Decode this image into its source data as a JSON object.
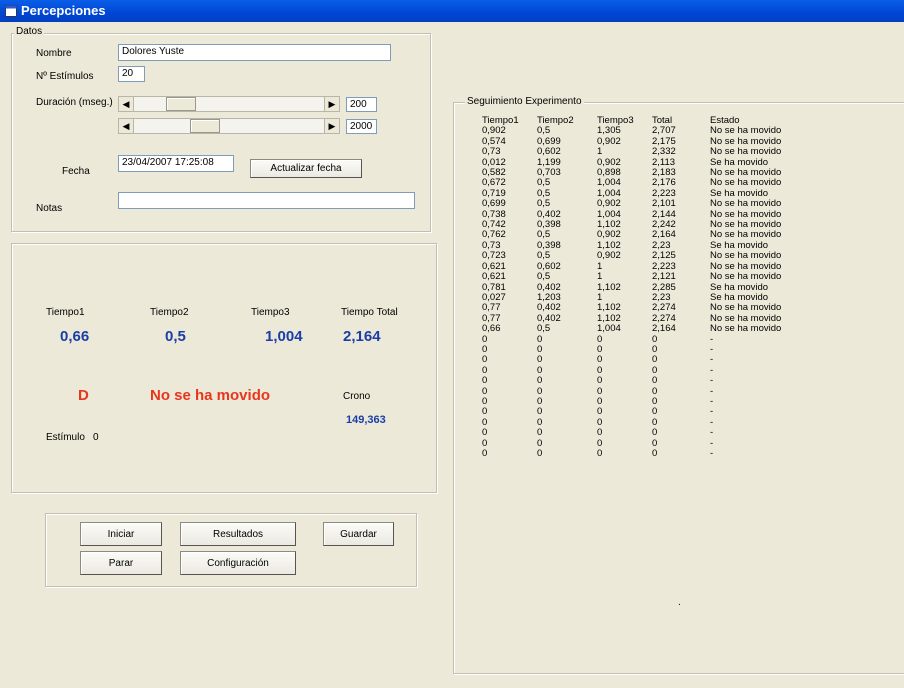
{
  "window": {
    "title": "Percepciones"
  },
  "datos": {
    "legend": "Datos",
    "nombre_label": "Nombre",
    "nombre_value": "Dolores Yuste",
    "estimulos_label": "Nº Estímulos",
    "estimulos_value": "20",
    "duracion_label": "Duración (mseg.)",
    "slider1_value": "200",
    "slider1_level": 0.2,
    "slider2_value": "2000",
    "slider2_level": 0.35,
    "fecha_label": "Fecha",
    "fecha_value": "23/04/2007 17:25:08",
    "actualizar_label": "Actualizar fecha",
    "notas_label": "Notas",
    "notas_value": ""
  },
  "display": {
    "tiempo1_label": "Tiempo1",
    "tiempo2_label": "Tiempo2",
    "tiempo3_label": "Tiempo3",
    "total_label": "Tiempo Total",
    "tiempo1_value": "0,66",
    "tiempo2_value": "0,5",
    "tiempo3_value": "1,004",
    "total_value": "2,164",
    "letter": "D",
    "estado": "No se ha movido",
    "crono_label": "Crono",
    "crono_value": "149,363",
    "estimulo_label": "Estímulo",
    "estimulo_value": "0"
  },
  "buttons": {
    "iniciar": "Iniciar",
    "resultados": "Resultados",
    "guardar": "Guardar",
    "parar": "Parar",
    "configuracion": "Configuración"
  },
  "seguimiento": {
    "legend": "Seguimiento Experimento",
    "headers": [
      "Tiempo1",
      "Tiempo2",
      "Tiempo3",
      "Total",
      "Estado"
    ],
    "rows": [
      [
        "0,902",
        "0,5",
        "1,305",
        "2,707",
        "No se ha movido"
      ],
      [
        "0,574",
        "0,699",
        "0,902",
        "2,175",
        "No se ha movido"
      ],
      [
        "0,73",
        "0,602",
        "1",
        "2,332",
        "No se ha movido"
      ],
      [
        "0,012",
        "1,199",
        "0,902",
        "2,113",
        "Se ha movido"
      ],
      [
        "0,582",
        "0,703",
        "0,898",
        "2,183",
        "No se ha movido"
      ],
      [
        "0,672",
        "0,5",
        "1,004",
        "2,176",
        "No se ha movido"
      ],
      [
        "0,719",
        "0,5",
        "1,004",
        "2,223",
        "Se ha movido"
      ],
      [
        "0,699",
        "0,5",
        "0,902",
        "2,101",
        "No se ha movido"
      ],
      [
        "0,738",
        "0,402",
        "1,004",
        "2,144",
        "No se ha movido"
      ],
      [
        "0,742",
        "0,398",
        "1,102",
        "2,242",
        "No se ha movido"
      ],
      [
        "0,762",
        "0,5",
        "0,902",
        "2,164",
        "No se ha movido"
      ],
      [
        "0,73",
        "0,398",
        "1,102",
        "2,23",
        "Se ha movido"
      ],
      [
        "0,723",
        "0,5",
        "0,902",
        "2,125",
        "No se ha movido"
      ],
      [
        "0,621",
        "0,602",
        "1",
        "2,223",
        "No se ha movido"
      ],
      [
        "0,621",
        "0,5",
        "1",
        "2,121",
        "No se ha movido"
      ],
      [
        "0,781",
        "0,402",
        "1,102",
        "2,285",
        "Se ha movido"
      ],
      [
        "0,027",
        "1,203",
        "1",
        "2,23",
        "Se ha movido"
      ],
      [
        "0,77",
        "0,402",
        "1,102",
        "2,274",
        "No se ha movido"
      ],
      [
        "0,77",
        "0,402",
        "1,102",
        "2,274",
        "No se ha movido"
      ],
      [
        "0,66",
        "0,5",
        "1,004",
        "2,164",
        "No se ha movido"
      ],
      [
        "0",
        "0",
        "0",
        "0",
        "-"
      ],
      [
        "0",
        "0",
        "0",
        "0",
        "-"
      ],
      [
        "0",
        "0",
        "0",
        "0",
        "-"
      ],
      [
        "0",
        "0",
        "0",
        "0",
        "-"
      ],
      [
        "0",
        "0",
        "0",
        "0",
        "-"
      ],
      [
        "0",
        "0",
        "0",
        "0",
        "-"
      ],
      [
        "0",
        "0",
        "0",
        "0",
        "-"
      ],
      [
        "0",
        "0",
        "0",
        "0",
        "-"
      ],
      [
        "0",
        "0",
        "0",
        "0",
        "-"
      ],
      [
        "0",
        "0",
        "0",
        "0",
        "-"
      ],
      [
        "0",
        "0",
        "0",
        "0",
        "-"
      ],
      [
        "0",
        "0",
        "0",
        "0",
        "-"
      ]
    ],
    "trailing_mark": "."
  },
  "colors": {
    "title_bar": "#0046d5",
    "value_blue": "#1a3da8",
    "alert_red": "#e8361d",
    "window_bg": "#ece9d8"
  }
}
